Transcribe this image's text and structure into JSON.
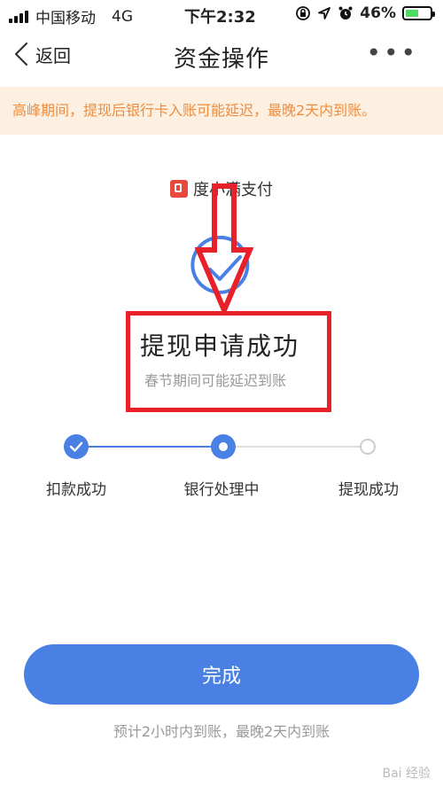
{
  "status": {
    "carrier": "中国移动",
    "network": "4G",
    "time": "下午2:32",
    "battery_percent": "46%",
    "battery_level": 0.46
  },
  "nav": {
    "back_label": "返回",
    "title": "资金操作",
    "more": "•••"
  },
  "notice": "高峰期间，提现后银行卡入账可能延迟，最晚2天内到账。",
  "brand": {
    "name": "度小满支付"
  },
  "result": {
    "title": "提现申请成功",
    "subtitle": "春节期间可能延迟到账"
  },
  "steps": [
    {
      "label": "扣款成功",
      "state": "done"
    },
    {
      "label": "银行处理中",
      "state": "current"
    },
    {
      "label": "提现成功",
      "state": "pending"
    }
  ],
  "done_button": "完成",
  "footnote": "预计2小时内到账，最晚2天内到账",
  "watermark": "Bai 经验",
  "colors": {
    "accent": "#4a80e4",
    "notice_text": "#f08c3c",
    "notice_bg": "#fdf0e1",
    "annotation": "#e8202a"
  }
}
